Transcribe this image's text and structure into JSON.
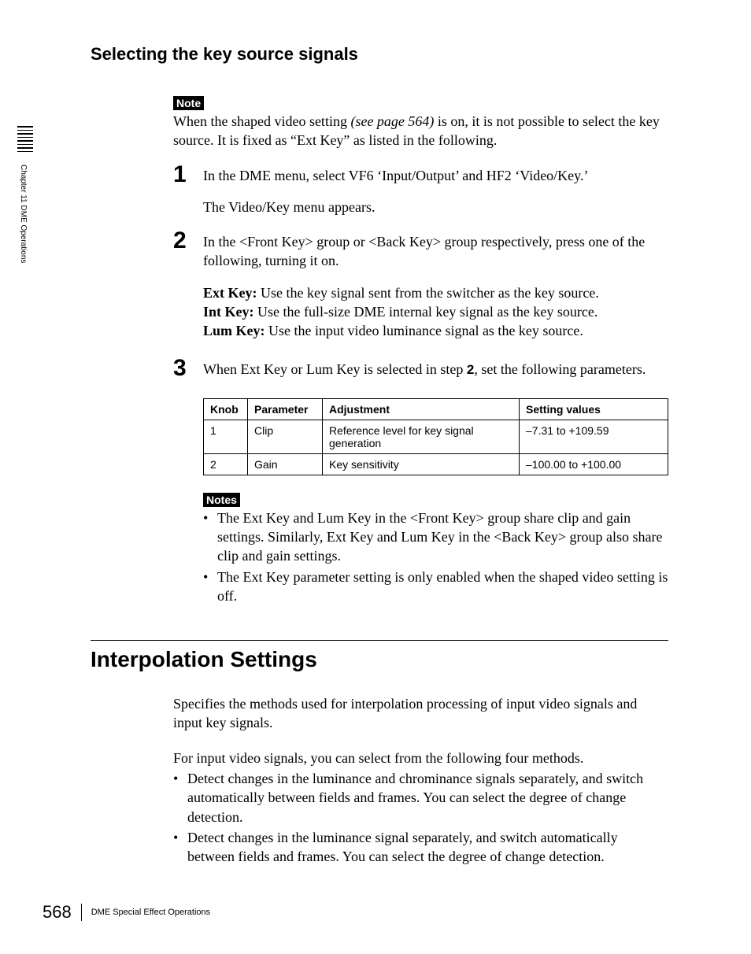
{
  "sidetab": {
    "chapter": "Chapter 11  DME Operations"
  },
  "heading_sub": "Selecting the key source signals",
  "note_label": "Note",
  "notes_label": "Notes",
  "note1_a": "When the shaped video setting ",
  "note1_link": "(see page 564)",
  "note1_b": " is on, it is not possible to select the key source. It is fixed as “Ext Key” as listed in the following.",
  "steps": {
    "1": {
      "n": "1",
      "p1": "In the DME menu, select VF6 ‘Input/Output’ and HF2 ‘Video/Key.’",
      "p2": "The Video/Key menu appears."
    },
    "2": {
      "n": "2",
      "p1": "In the <Front Key> group or <Back Key> group respectively, press one of the following, turning it on.",
      "ext_l": "Ext Key:",
      "ext_t": " Use the key signal sent from the switcher as the key source.",
      "int_l": "Int Key:",
      "int_t": " Use the full-size DME internal key signal as the key source.",
      "lum_l": "Lum Key:",
      "lum_t": " Use the input video luminance signal as the key source."
    },
    "3": {
      "n": "3",
      "p1a": "When Ext Key or Lum Key is selected in step ",
      "p1b": "2",
      "p1c": ", set the following parameters."
    }
  },
  "table": {
    "h_knob": "Knob",
    "h_param": "Parameter",
    "h_adj": "Adjustment",
    "h_set": "Setting values",
    "r1_knob": "1",
    "r1_param": "Clip",
    "r1_adj": "Reference level for key signal generation",
    "r1_set": "–7.31 to +109.59",
    "r2_knob": "2",
    "r2_param": "Gain",
    "r2_adj": "Key sensitivity",
    "r2_set": "–100.00 to +100.00"
  },
  "notes2": {
    "b1": "The Ext Key and Lum Key in the <Front Key> group share clip and gain settings. Similarly, Ext Key and Lum Key in the <Back Key> group also share clip and gain settings.",
    "b2": "The Ext Key parameter setting is only enabled when the shaped video setting is off."
  },
  "section2": {
    "title": "Interpolation Settings",
    "intro": "Specifies the methods used for interpolation processing of input video signals and input key signals.",
    "lead": "For input video signals, you can select from the following four methods.",
    "b1": "Detect changes in the luminance and chrominance signals separately, and switch automatically between fields and frames. You can select the degree of change detection.",
    "b2": "Detect changes in the luminance signal separately, and switch automatically between fields and frames. You can select the degree of change detection."
  },
  "footer": {
    "page": "568",
    "title": "DME Special Effect Operations"
  }
}
